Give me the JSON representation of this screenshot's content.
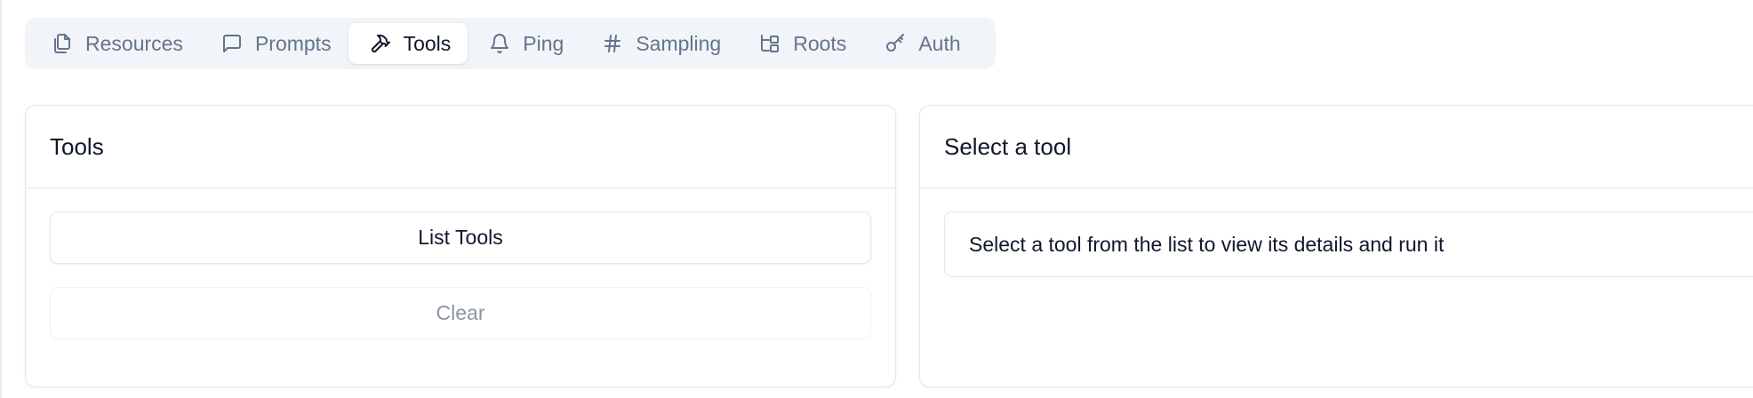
{
  "tabs": [
    {
      "label": "Resources",
      "icon": "files-icon",
      "active": false
    },
    {
      "label": "Prompts",
      "icon": "message-square-icon",
      "active": false
    },
    {
      "label": "Tools",
      "icon": "hammer-icon",
      "active": true
    },
    {
      "label": "Ping",
      "icon": "bell-icon",
      "active": false
    },
    {
      "label": "Sampling",
      "icon": "hash-icon",
      "active": false
    },
    {
      "label": "Roots",
      "icon": "folder-tree-icon",
      "active": false
    },
    {
      "label": "Auth",
      "icon": "key-icon",
      "active": false
    }
  ],
  "tools_panel": {
    "title": "Tools",
    "list_button": "List Tools",
    "clear_button": "Clear"
  },
  "detail_panel": {
    "title": "Select a tool",
    "message": "Select a tool from the list to view its details and run it"
  },
  "colors": {
    "tabbar_bg": "#f1f5f9",
    "inactive_text": "#64748b",
    "active_text": "#0f172a",
    "border": "#e2e8f0",
    "disabled_text": "#8c94a0"
  }
}
